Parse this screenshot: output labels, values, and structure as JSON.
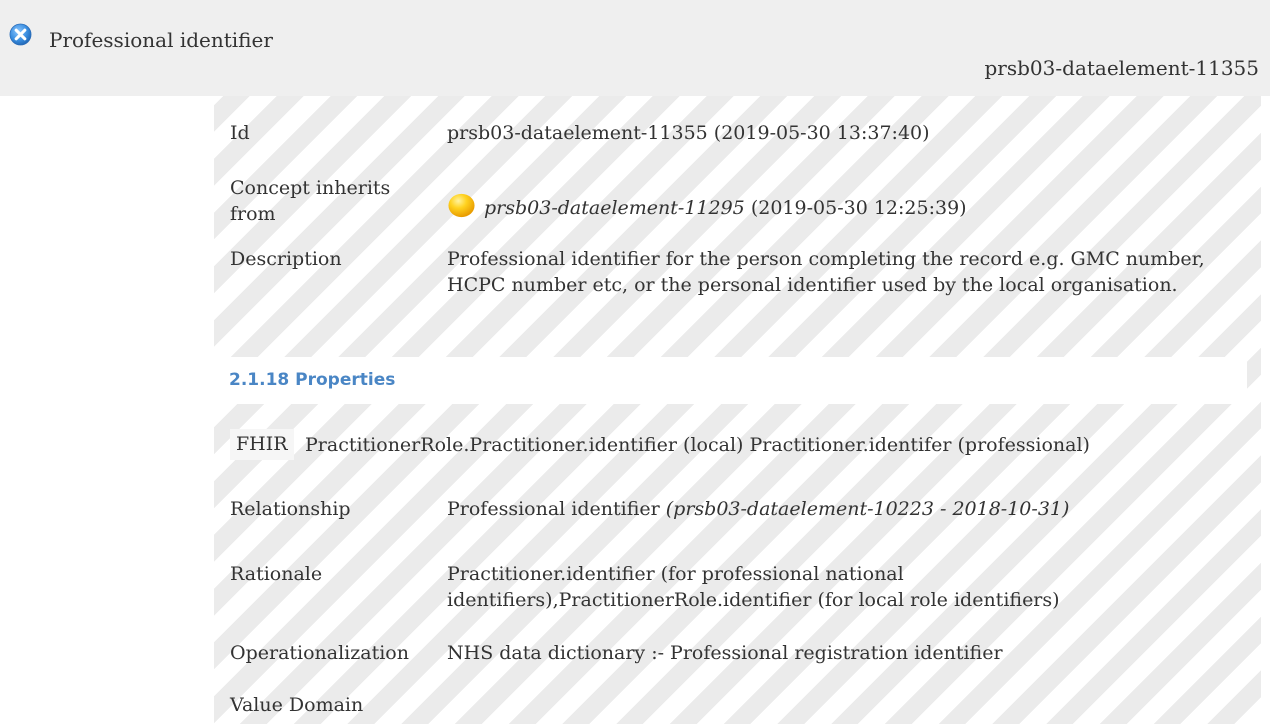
{
  "header": {
    "title": "Professional identifier",
    "element_id": "prsb03-dataelement-11355",
    "close_icon": "close-icon",
    "close_color": "#3a8ee0"
  },
  "details": {
    "id_label": "Id",
    "id_value": "prsb03-dataelement-11355 (2019-05-30 13:37:40)",
    "inherits_label_line1": "Concept inherits",
    "inherits_label_line2": "from",
    "inherits_link": "prsb03-dataelement-11295",
    "inherits_date": "(2019-05-30 12:25:39)",
    "inherits_icon": "status-ball-icon",
    "inherits_icon_color": "#f5b800",
    "description_label": "Description",
    "description_line1": "Professional identifier for the person completing the record e.g. GMC number,",
    "description_line2": "HCPC number etc, or the personal identifier used by the local organisation."
  },
  "properties": {
    "section_title": "2.1.18 Properties",
    "section_color": "#4a86c5",
    "fhir_badge": "FHIR",
    "fhir_value": "PractitionerRole.Practitioner.identifier (local) Practitioner.identifer (professional)",
    "relationship_label": "Relationship",
    "relationship_value": "Professional identifier",
    "relationship_ref": "(prsb03-dataelement-10223 - 2018-10-31)",
    "rationale_label": "Rationale",
    "rationale_line1": "Practitioner.identifier (for professional national",
    "rationale_line2": "identifiers),PractitionerRole.identifier (for local role identifiers)",
    "operationalization_label": "Operationalization",
    "operationalization_value": "NHS data dictionary :- Professional registration identifier",
    "value_domain_label": "Value Domain"
  }
}
